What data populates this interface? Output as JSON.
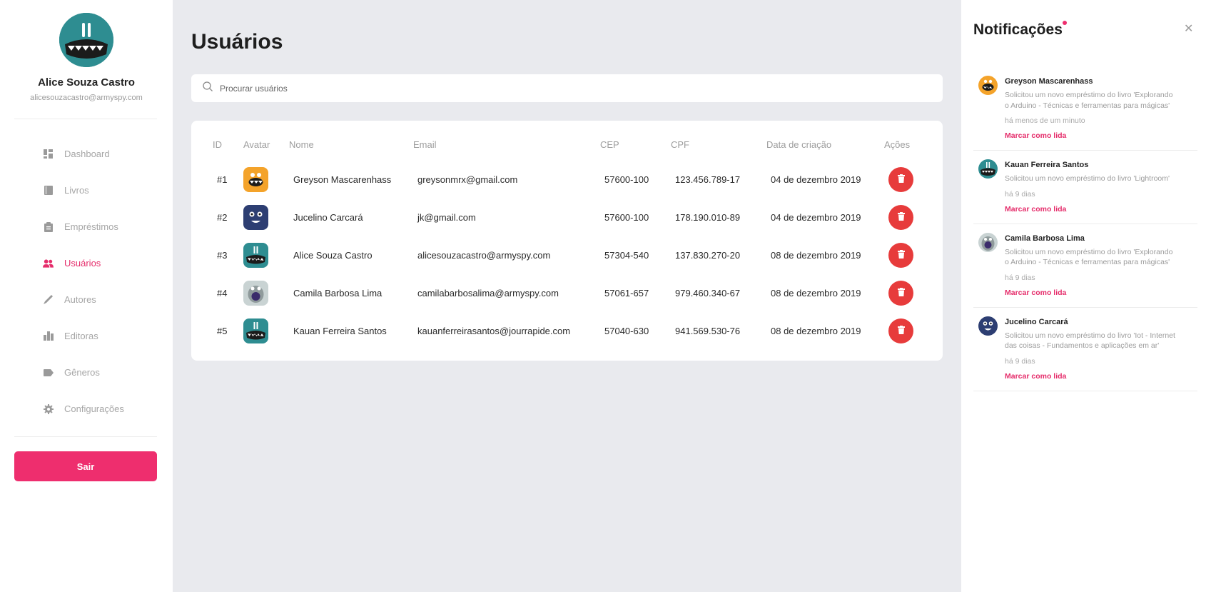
{
  "user": {
    "name": "Alice Souza Castro",
    "email": "alicesouzacastro@armyspy.com"
  },
  "nav": [
    {
      "label": "Dashboard",
      "icon": "dashboard-icon",
      "active": false
    },
    {
      "label": "Livros",
      "icon": "book-icon",
      "active": false
    },
    {
      "label": "Empréstimos",
      "icon": "clipboard-icon",
      "active": false
    },
    {
      "label": "Usuários",
      "icon": "users-icon",
      "active": true
    },
    {
      "label": "Autores",
      "icon": "pen-icon",
      "active": false
    },
    {
      "label": "Editoras",
      "icon": "building-icon",
      "active": false
    },
    {
      "label": "Gêneros",
      "icon": "tag-icon",
      "active": false
    },
    {
      "label": "Configurações",
      "icon": "gear-icon",
      "active": false
    }
  ],
  "logout_label": "Sair",
  "page_title": "Usuários",
  "search": {
    "placeholder": "Procurar usuários"
  },
  "table": {
    "headers": {
      "id": "ID",
      "avatar": "Avatar",
      "nome": "Nome",
      "email": "Email",
      "cep": "CEP",
      "cpf": "CPF",
      "data": "Data de criação",
      "acoes": "Ações"
    },
    "rows": [
      {
        "id": "#1",
        "avatar": "orange-monster-avatar",
        "nome": "Greyson Mascarenhass",
        "email": "greysonmrx@gmail.com",
        "cep": "57600-100",
        "cpf": "123.456.789-17",
        "data": "04 de dezembro 2019"
      },
      {
        "id": "#2",
        "avatar": "navy-monster-avatar",
        "nome": "Jucelino Carcará",
        "email": "jk@gmail.com",
        "cep": "57600-100",
        "cpf": "178.190.010-89",
        "data": "04 de dezembro 2019"
      },
      {
        "id": "#3",
        "avatar": "teal-monster-avatar",
        "nome": "Alice Souza Castro",
        "email": "alicesouzacastro@armyspy.com",
        "cep": "57304-540",
        "cpf": "137.830.270-20",
        "data": "08 de dezembro 2019"
      },
      {
        "id": "#4",
        "avatar": "gray-monster-avatar",
        "nome": "Camila Barbosa Lima",
        "email": "camilabarbosalima@armyspy.com",
        "cep": "57061-657",
        "cpf": "979.460.340-67",
        "data": "08 de dezembro 2019"
      },
      {
        "id": "#5",
        "avatar": "teal-monster-avatar",
        "nome": "Kauan Ferreira Santos",
        "email": "kauanferreirasantos@jourrapide.com",
        "cep": "57040-630",
        "cpf": "941.569.530-76",
        "data": "08 de dezembro 2019"
      }
    ]
  },
  "notifications": {
    "title": "Notificações",
    "items": [
      {
        "name": "Greyson Mascarenhass",
        "message": "Solicitou um novo empréstimo do livro 'Explorando o Arduino - Técnicas e ferramentas para mágicas'",
        "time": "há menos de um minuto",
        "action": "Marcar como lida",
        "avatar": "orange-monster-avatar"
      },
      {
        "name": "Kauan Ferreira Santos",
        "message": "Solicitou um novo empréstimo do livro 'Lightroom'",
        "time": "há 9 dias",
        "action": "Marcar como lida",
        "avatar": "teal-monster-avatar"
      },
      {
        "name": "Camila Barbosa Lima",
        "message": "Solicitou um novo empréstimo do livro 'Explorando o Arduino - Técnicas e ferramentas para mágicas'",
        "time": "há 9 dias",
        "action": "Marcar como lida",
        "avatar": "gray-monster-avatar"
      },
      {
        "name": "Jucelino Carcará",
        "message": "Solicitou um novo empréstimo do livro 'Iot - Internet das coisas - Fundamentos e aplicações em ar'",
        "time": "há 9 dias",
        "action": "Marcar como lida",
        "avatar": "navy-monster-avatar"
      }
    ]
  },
  "colors": {
    "accent": "#ee2e6e",
    "danger": "#e73b3b",
    "teal_avatar": "#2e8d91",
    "orange_avatar": "#f4a32a",
    "navy_avatar": "#2d3e72",
    "gray_avatar": "#9aa7a8"
  }
}
